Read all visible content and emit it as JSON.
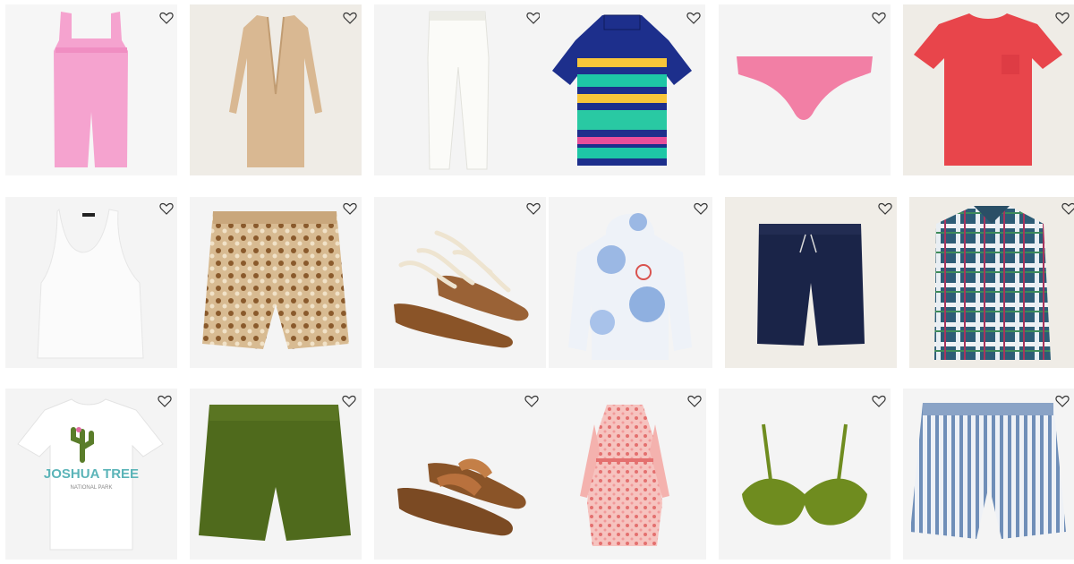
{
  "grid": {
    "items": [
      {
        "product": "pink linen romper",
        "bg": "#f6f6f6",
        "color": "#f5a3cf"
      },
      {
        "product": "camel sweater-blazer coat",
        "bg": "#efece6",
        "color": "#d9b892"
      },
      {
        "product": "white linen jogger pants",
        "bg": "#f4f4f4",
        "color": "#f3f3ef"
      },
      {
        "product": "multicolor striped polo shirt",
        "bg": "#f4f4f4",
        "color": "#1d2f8c"
      },
      {
        "product": "pink bikini bottom",
        "bg": "#f4f4f4",
        "color": "#f27fa5"
      },
      {
        "product": "red pocket t-shirt",
        "bg": "#efece6",
        "color": "#e8454b"
      },
      {
        "product": "white ribbed tank top",
        "bg": "#f4f4f4",
        "color": "#fbfbfb"
      },
      {
        "product": "paisley print shorts",
        "bg": "#f4f4f4",
        "color": "#c9a77c"
      },
      {
        "product": "rope lace-up sandals",
        "bg": "#f4f4f4",
        "color": "#9a6236"
      },
      {
        "product": "tie-dye hoodie",
        "bg": "#f4f4f4",
        "color": "#9bb8e4"
      },
      {
        "product": "navy drawstring shorts",
        "bg": "#f0ede7",
        "color": "#1a2448"
      },
      {
        "product": "plaid flannel shirt",
        "bg": "#efece6",
        "color": "#2d5c76"
      },
      {
        "product": "graphic tee",
        "bg": "#f4f4f4",
        "color": "#ffffff"
      },
      {
        "product": "olive linen shorts",
        "bg": "#f4f4f4",
        "color": "#4f6a1c"
      },
      {
        "product": "leather toe-loop sandals",
        "bg": "#f4f4f4",
        "color": "#b9713d"
      },
      {
        "product": "pink floral dress",
        "bg": "#f4f4f4",
        "color": "#f19a9a"
      },
      {
        "product": "green ribbed bikini top",
        "bg": "#f4f4f4",
        "color": "#6f8c1f"
      },
      {
        "product": "blue striped shorts",
        "bg": "#f4f4f4",
        "color": "#6f8eb8"
      }
    ],
    "graphic_tee_text": {
      "title": "JOSHUA TREE",
      "subtitle": "NATIONAL PARK"
    },
    "icons": {
      "wishlist": "heart-outline-icon"
    }
  }
}
